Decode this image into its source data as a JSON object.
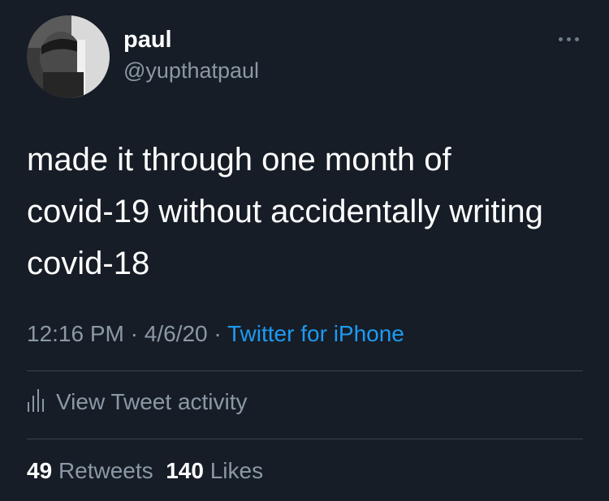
{
  "author": {
    "display_name": "paul",
    "handle": "@yupthatpaul"
  },
  "tweet": {
    "text": "made it through one month of\ncovid-19 without accidentally writing\ncovid-18",
    "time": "12:16 PM",
    "separator1": " · ",
    "date": "4/6/20",
    "separator2": " · ",
    "source": "Twitter for iPhone"
  },
  "activity": {
    "label": "View Tweet activity",
    "icon": "bar-chart-icon"
  },
  "stats": {
    "retweets_count": "49",
    "retweets_label": "Retweets",
    "likes_count": "140",
    "likes_label": "Likes"
  },
  "more_icon": "more-horizontal-icon",
  "colors": {
    "background": "#161d27",
    "secondary_text": "#8b98a5",
    "link": "#1d9bf0",
    "divider": "#38444d"
  }
}
